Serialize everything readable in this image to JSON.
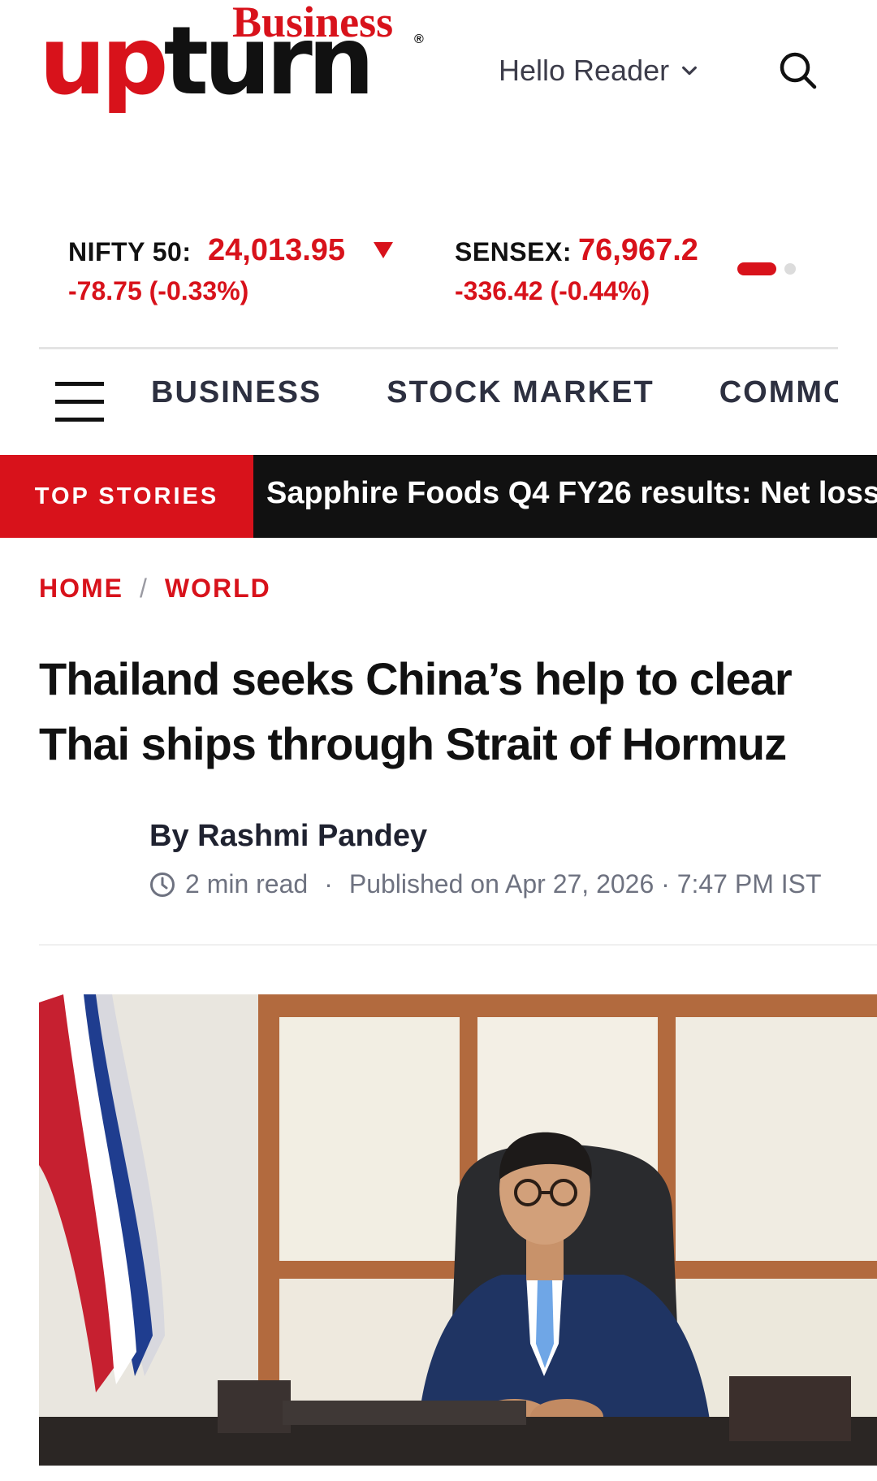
{
  "header": {
    "logo_top": "Business",
    "logo_word_red": "up",
    "logo_word_dark": "turn",
    "logo_reg": "®",
    "greeting": "Hello Reader",
    "search_icon": "search-icon",
    "chevron_icon": "chevron-down-icon"
  },
  "ticker": {
    "indices": [
      {
        "label": "NIFTY 50:",
        "value": "24,013.95",
        "change": "-78.75 (-0.33%)",
        "direction": "down"
      },
      {
        "label": "SENSEX:",
        "value": "76,967.2",
        "change": "-336.42 (-0.44%)"
      }
    ],
    "color_negative": "#d8121b"
  },
  "nav": {
    "items": [
      "BUSINESS",
      "STOCK MARKET",
      "COMMODITIES"
    ]
  },
  "top_stories": {
    "label": "TOP STORIES",
    "headline": "Sapphire Foods Q4 FY26 results: Net loss"
  },
  "breadcrumb": {
    "home": "HOME",
    "separator": "/",
    "section": "WORLD"
  },
  "article": {
    "title": "Thailand seeks China’s help to clear Thai ships through Strait of Hormuz",
    "byline": "By Rashmi Pandey",
    "read_time": "2 min read",
    "dot": "·",
    "published": "Published on Apr 27, 2026 · 7:47 PM IST"
  },
  "colors": {
    "brand_red": "#d8121b",
    "dark": "#111111"
  }
}
